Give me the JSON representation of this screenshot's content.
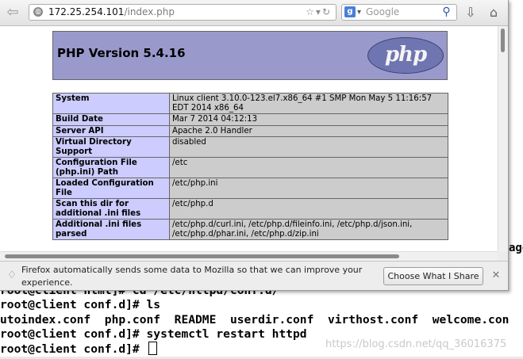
{
  "browser": {
    "url_host": "172.25.254.101",
    "url_path": "/index.php",
    "search_placeholder": "Google",
    "search_engine_letter": "g"
  },
  "phpinfo": {
    "title": "PHP Version 5.4.16",
    "logo_text": "php",
    "rows": [
      {
        "key": "System",
        "value": "Linux client 3.10.0-123.el7.x86_64 #1 SMP Mon May 5 11:16:57 EDT 2014 x86_64"
      },
      {
        "key": "Build Date",
        "value": "Mar 7 2014 04:12:13"
      },
      {
        "key": "Server API",
        "value": "Apache 2.0 Handler"
      },
      {
        "key": "Virtual Directory Support",
        "value": "disabled"
      },
      {
        "key": "Configuration File (php.ini) Path",
        "value": "/etc"
      },
      {
        "key": "Loaded Configuration File",
        "value": "/etc/php.ini"
      },
      {
        "key": "Scan this dir for additional .ini files",
        "value": "/etc/php.d"
      },
      {
        "key": "Additional .ini files parsed",
        "value": "/etc/php.d/curl.ini, /etc/php.d/fileinfo.ini, /etc/php.d/json.ini, /etc/php.d/phar.ini, /etc/php.d/zip.ini"
      }
    ]
  },
  "notification": {
    "text": "Firefox automatically sends some data to Mozilla so that we can improve your experience.",
    "button_label": "Choose What I Share",
    "close_glyph": "✕"
  },
  "terminal": {
    "lines": [
      "root@client html]# cd /etc/httpd/conf.d/",
      "root@client conf.d]# ls",
      "utoindex.conf  php.conf  README  userdir.conf  virthost.conf  welcome.con",
      "root@client conf.d]# systemctl restart httpd",
      "root@client conf.d]# "
    ],
    "side_fragment": "age",
    "watermark": "https://blog.csdn.net/qq_36016375"
  }
}
